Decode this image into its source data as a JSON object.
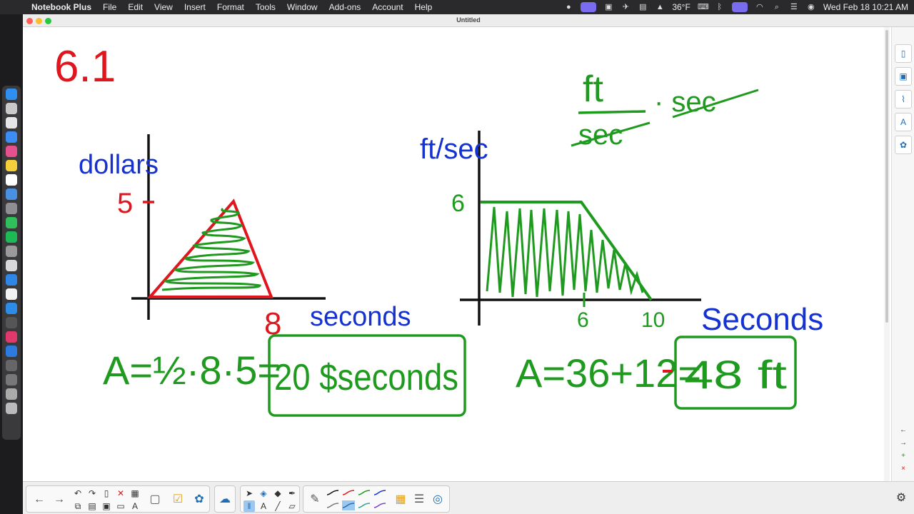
{
  "menubar": {
    "apple_icon": "apple-logo-icon",
    "app_name": "Notebook Plus",
    "menus": [
      "File",
      "Edit",
      "View",
      "Insert",
      "Format",
      "Tools",
      "Window",
      "Add-ons",
      "Account",
      "Help"
    ],
    "weather": "36°F",
    "datetime": "Wed Feb 18  10:21 AM"
  },
  "window": {
    "title": "Untitled"
  },
  "canvas": {
    "section_label": "6.1",
    "left_graph": {
      "y_axis_label": "dollars",
      "y_tick": "5",
      "x_tick": "8",
      "x_axis_label": "seconds",
      "equation": "A=½·8·5=",
      "answer": "20 $seconds"
    },
    "right_graph": {
      "y_axis_label": "ft/sec",
      "y_tick": "6",
      "x_tick_1": "6",
      "x_tick_2": "10",
      "x_axis_label": "Seconds",
      "equation": "A=36+12=",
      "answer": "48 ft"
    },
    "units_numerator": "ft",
    "units_denominator": "sec",
    "units_times": "· sec"
  },
  "colors": {
    "ink_red": "#e0161e",
    "ink_green": "#1e9a1e",
    "ink_blue": "#1432d2",
    "ink_black": "#111111"
  },
  "toolbar": {
    "tools": [
      "back-arrow-icon",
      "forward-arrow-icon",
      "undo-icon",
      "redo-icon",
      "page-icon",
      "delete-icon",
      "table-icon",
      "screen-shade-icon",
      "response-icon",
      "add-ons-icon",
      "select-icon",
      "shapes-icon",
      "fill-icon",
      "text-icon",
      "line-icon",
      "eraser-icon",
      "pen-icon",
      "color-palette-icon",
      "properties-icon",
      "magic-pen-icon",
      "settings-gear-icon"
    ]
  }
}
